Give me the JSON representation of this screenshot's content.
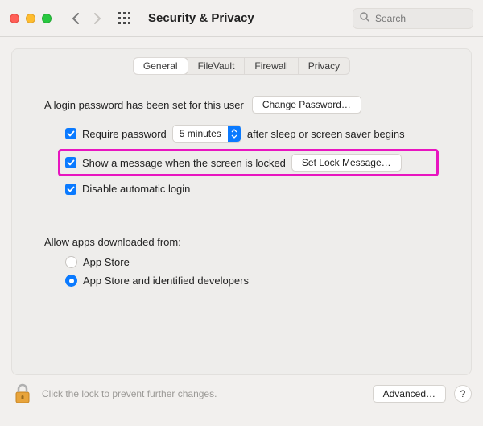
{
  "window": {
    "title": "Security & Privacy",
    "search_placeholder": "Search"
  },
  "tabs": {
    "general": "General",
    "filevault": "FileVault",
    "firewall": "Firewall",
    "privacy": "Privacy"
  },
  "login": {
    "text": "A login password has been set for this user",
    "change_btn": "Change Password…"
  },
  "options": {
    "require_pw_pre": "Require password",
    "require_pw_delay": "5 minutes",
    "require_pw_post": "after sleep or screen saver begins",
    "show_message": "Show a message when the screen is locked",
    "set_lock_btn": "Set Lock Message…",
    "disable_auto_login": "Disable automatic login"
  },
  "downloads_section": {
    "heading": "Allow apps downloaded from:",
    "opt_appstore": "App Store",
    "opt_identified": "App Store and identified developers"
  },
  "footer": {
    "lock_text": "Click the lock to prevent further changes.",
    "advanced_btn": "Advanced…",
    "help": "?"
  }
}
